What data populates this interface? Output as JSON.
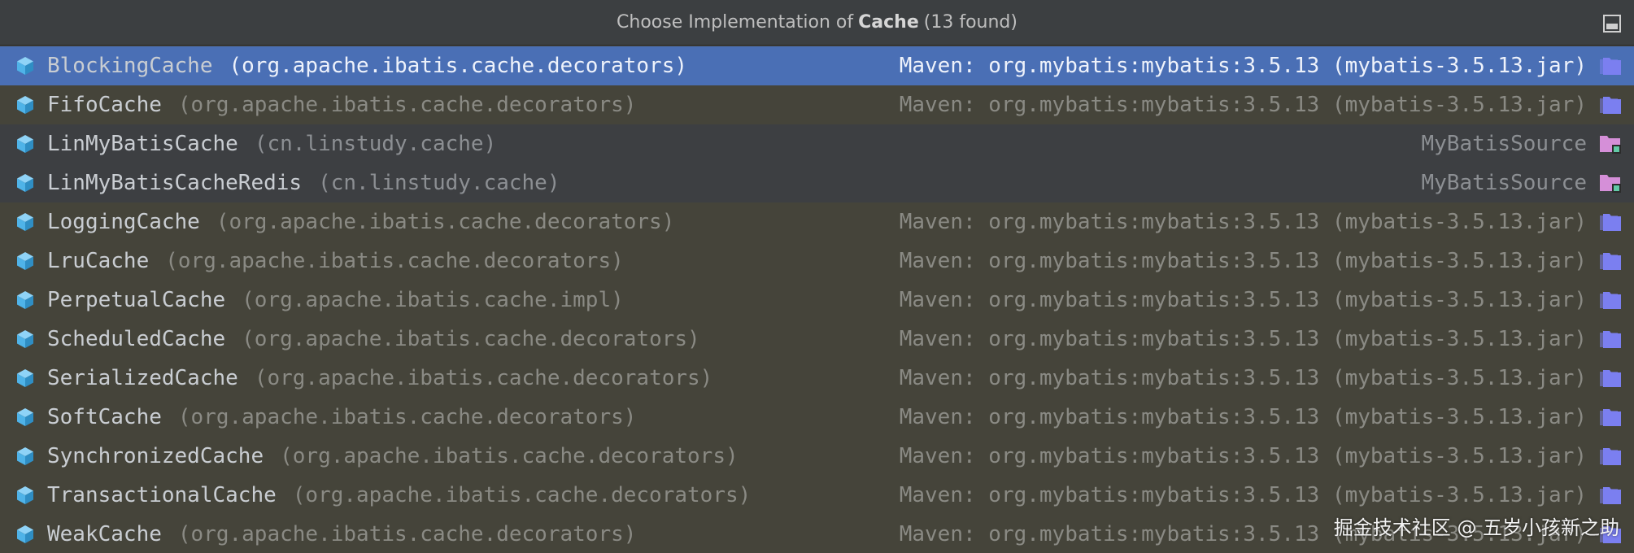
{
  "header": {
    "prefix": "Choose Implementation of",
    "target": "Cache",
    "suffix": "(13 found)",
    "pin_icon": "pin-window-icon"
  },
  "colors": {
    "selected_row": "#4a6fb5",
    "library_row": "#45443a",
    "project_row": "#3d3f42",
    "class_icon": "#4fb3e8",
    "library_folder_icon": "#7b7ff0",
    "project_folder_icon": "#d58fd8"
  },
  "items": [
    {
      "name": "BlockingCache",
      "package": "(org.apache.ibatis.cache.decorators)",
      "location": "Maven: org.mybatis:mybatis:3.5.13 (mybatis-3.5.13.jar)",
      "kind": "library",
      "selected": true
    },
    {
      "name": "FifoCache",
      "package": "(org.apache.ibatis.cache.decorators)",
      "location": "Maven: org.mybatis:mybatis:3.5.13 (mybatis-3.5.13.jar)",
      "kind": "library",
      "selected": false
    },
    {
      "name": "LinMyBatisCache",
      "package": "(cn.linstudy.cache)",
      "location": "MyBatisSource",
      "kind": "project",
      "selected": false
    },
    {
      "name": "LinMyBatisCacheRedis",
      "package": "(cn.linstudy.cache)",
      "location": "MyBatisSource",
      "kind": "project",
      "selected": false
    },
    {
      "name": "LoggingCache",
      "package": "(org.apache.ibatis.cache.decorators)",
      "location": "Maven: org.mybatis:mybatis:3.5.13 (mybatis-3.5.13.jar)",
      "kind": "library",
      "selected": false
    },
    {
      "name": "LruCache",
      "package": "(org.apache.ibatis.cache.decorators)",
      "location": "Maven: org.mybatis:mybatis:3.5.13 (mybatis-3.5.13.jar)",
      "kind": "library",
      "selected": false
    },
    {
      "name": "PerpetualCache",
      "package": "(org.apache.ibatis.cache.impl)",
      "location": "Maven: org.mybatis:mybatis:3.5.13 (mybatis-3.5.13.jar)",
      "kind": "library",
      "selected": false
    },
    {
      "name": "ScheduledCache",
      "package": "(org.apache.ibatis.cache.decorators)",
      "location": "Maven: org.mybatis:mybatis:3.5.13 (mybatis-3.5.13.jar)",
      "kind": "library",
      "selected": false
    },
    {
      "name": "SerializedCache",
      "package": "(org.apache.ibatis.cache.decorators)",
      "location": "Maven: org.mybatis:mybatis:3.5.13 (mybatis-3.5.13.jar)",
      "kind": "library",
      "selected": false
    },
    {
      "name": "SoftCache",
      "package": "(org.apache.ibatis.cache.decorators)",
      "location": "Maven: org.mybatis:mybatis:3.5.13 (mybatis-3.5.13.jar)",
      "kind": "library",
      "selected": false
    },
    {
      "name": "SynchronizedCache",
      "package": "(org.apache.ibatis.cache.decorators)",
      "location": "Maven: org.mybatis:mybatis:3.5.13 (mybatis-3.5.13.jar)",
      "kind": "library",
      "selected": false
    },
    {
      "name": "TransactionalCache",
      "package": "(org.apache.ibatis.cache.decorators)",
      "location": "Maven: org.mybatis:mybatis:3.5.13 (mybatis-3.5.13.jar)",
      "kind": "library",
      "selected": false
    },
    {
      "name": "WeakCache",
      "package": "(org.apache.ibatis.cache.decorators)",
      "location": "Maven: org.mybatis:mybatis:3.5.13 (mybatis-3.5.13.jar)",
      "kind": "library",
      "selected": false
    }
  ],
  "watermark": "掘金技术社区 @ 五岁小孩新之助"
}
